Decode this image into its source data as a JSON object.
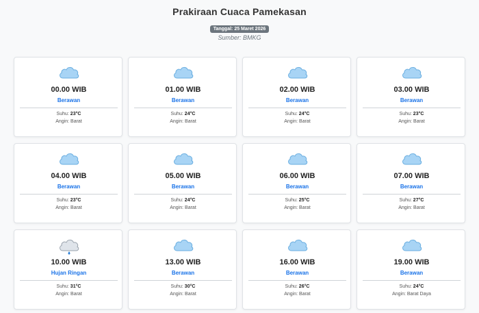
{
  "header": {
    "title": "Prakiraan Cuaca Pamekasan",
    "date_badge": "Tanggal: 25 Maret 2026",
    "source": "Sumber: BMKG"
  },
  "labels": {
    "temp_prefix": "Suhu: ",
    "wind_prefix": "Angin: "
  },
  "colors": {
    "accent": "#1a73e8",
    "cloud_fill": "#a8d4f5",
    "cloud_stroke": "#6aaee0",
    "rain_cloud_fill": "#dfe4ea",
    "rain_cloud_stroke": "#9aa3ad",
    "badge": "#6c757d"
  },
  "forecasts": [
    {
      "time": "00.00 WIB",
      "condition": "Berawan",
      "temp": "23°C",
      "wind": "Barat",
      "icon": "cloud-icon"
    },
    {
      "time": "01.00 WIB",
      "condition": "Berawan",
      "temp": "24°C",
      "wind": "Barat",
      "icon": "cloud-icon"
    },
    {
      "time": "02.00 WIB",
      "condition": "Berawan",
      "temp": "24°C",
      "wind": "Barat",
      "icon": "cloud-icon"
    },
    {
      "time": "03.00 WIB",
      "condition": "Berawan",
      "temp": "23°C",
      "wind": "Barat",
      "icon": "cloud-icon"
    },
    {
      "time": "04.00 WIB",
      "condition": "Berawan",
      "temp": "23°C",
      "wind": "Barat",
      "icon": "cloud-icon"
    },
    {
      "time": "05.00 WIB",
      "condition": "Berawan",
      "temp": "24°C",
      "wind": "Barat",
      "icon": "cloud-icon"
    },
    {
      "time": "06.00 WIB",
      "condition": "Berawan",
      "temp": "25°C",
      "wind": "Barat",
      "icon": "cloud-icon"
    },
    {
      "time": "07.00 WIB",
      "condition": "Berawan",
      "temp": "27°C",
      "wind": "Barat",
      "icon": "cloud-icon"
    },
    {
      "time": "10.00 WIB",
      "condition": "Hujan Ringan",
      "temp": "31°C",
      "wind": "Barat",
      "icon": "rain-cloud-icon"
    },
    {
      "time": "13.00 WIB",
      "condition": "Berawan",
      "temp": "30°C",
      "wind": "Barat",
      "icon": "cloud-icon"
    },
    {
      "time": "16.00 WIB",
      "condition": "Berawan",
      "temp": "26°C",
      "wind": "Barat",
      "icon": "cloud-icon"
    },
    {
      "time": "19.00 WIB",
      "condition": "Berawan",
      "temp": "24°C",
      "wind": "Barat Daya",
      "icon": "cloud-icon"
    }
  ]
}
